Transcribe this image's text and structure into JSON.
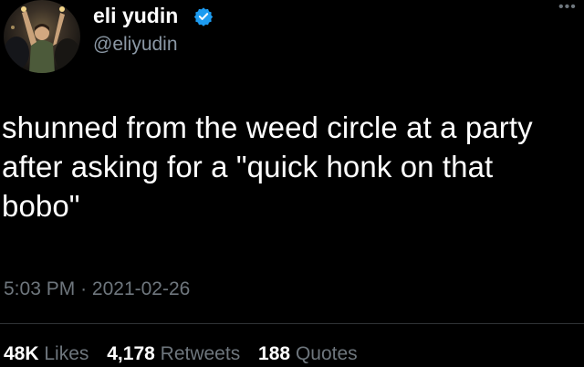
{
  "author": {
    "display_name": "eli yudin",
    "handle": "@eliyudin",
    "verified_icon": "verified-badge-icon",
    "avatar_icon": "profile-photo"
  },
  "tweet": {
    "text": "shunned from the weed circle at a party\nafter asking for a \"quick honk on that\nbobo\"",
    "time": "5:03 PM",
    "separator": "·",
    "date": "2021-02-26"
  },
  "stats": {
    "likes_count": "48K",
    "likes_label": "Likes",
    "retweets_count": "4,178",
    "retweets_label": "Retweets",
    "quotes_count": "188",
    "quotes_label": "Quotes"
  },
  "colors": {
    "background": "#000000",
    "text": "#ffffff",
    "secondary": "#6e767d",
    "verified": "#1d9bf0"
  }
}
